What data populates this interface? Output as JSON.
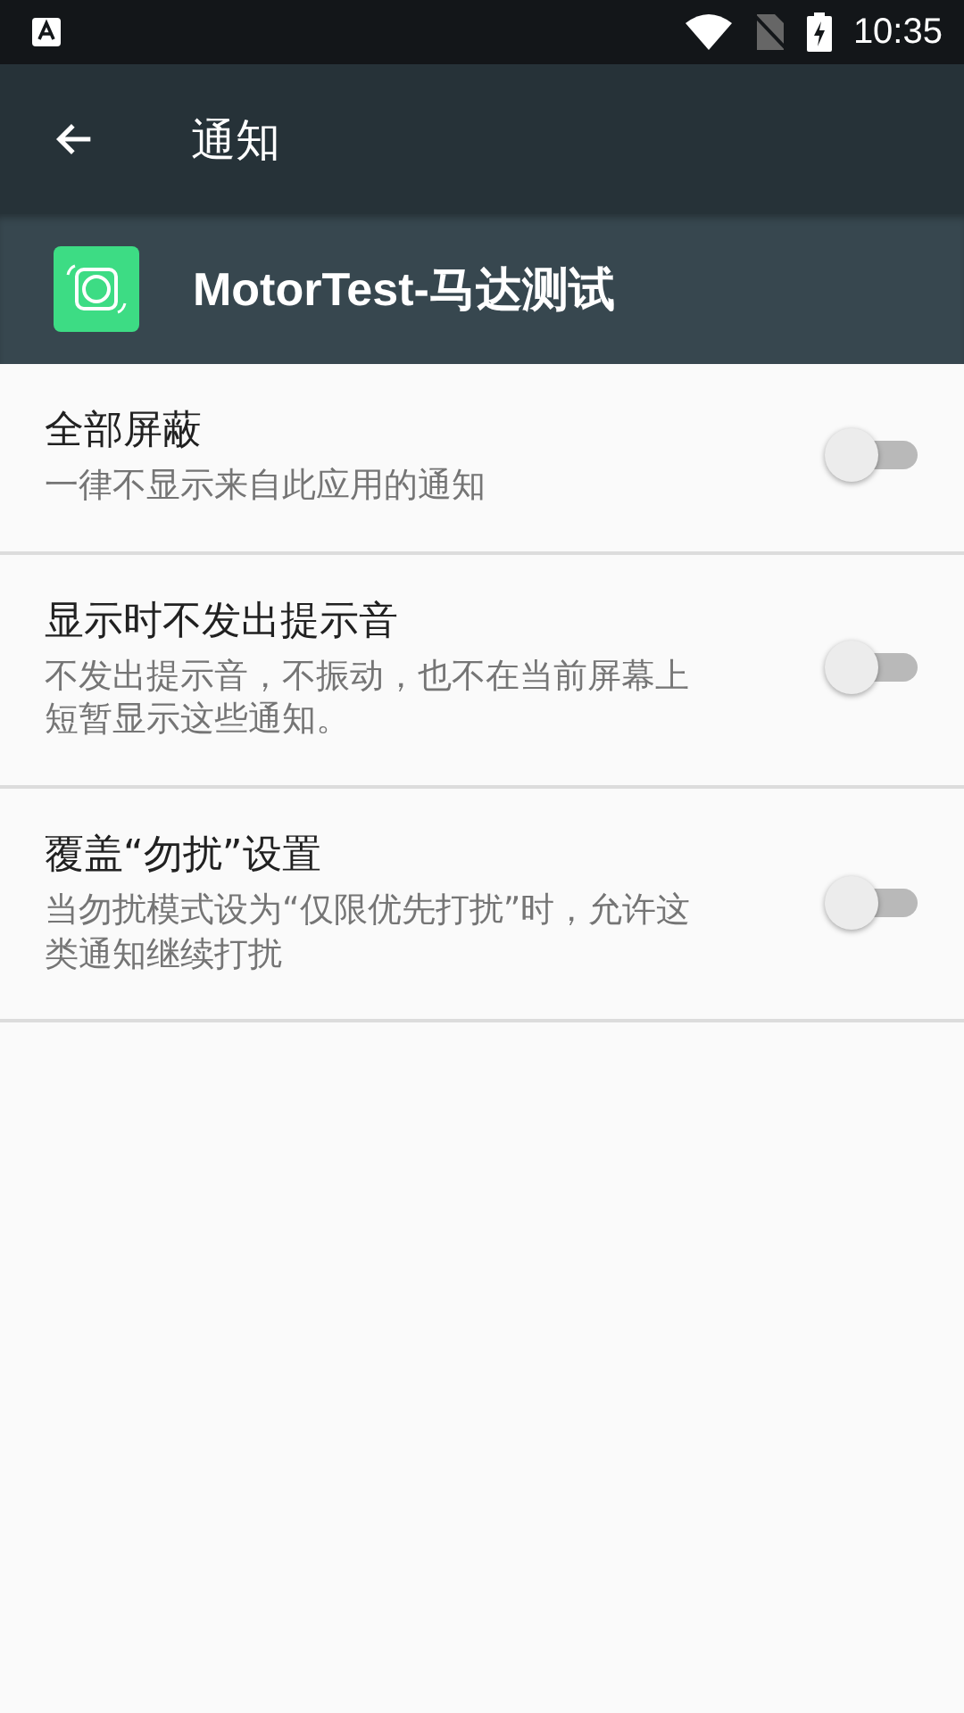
{
  "status_bar": {
    "time": "10:35"
  },
  "toolbar": {
    "title": "通知"
  },
  "app": {
    "name": "MotorTest-马达测试"
  },
  "settings": [
    {
      "title": "全部屏蔽",
      "description": "一律不显示来自此应用的通知",
      "on": false
    },
    {
      "title": "显示时不发出提示音",
      "description": "不发出提示音，不振动，也不在当前屏幕上短暂显示这些通知。",
      "on": false
    },
    {
      "title": "覆盖“勿扰”设置",
      "description": "当勿扰模式设为“仅限优先打扰”时，允许这类通知继续打扰",
      "on": false
    }
  ]
}
